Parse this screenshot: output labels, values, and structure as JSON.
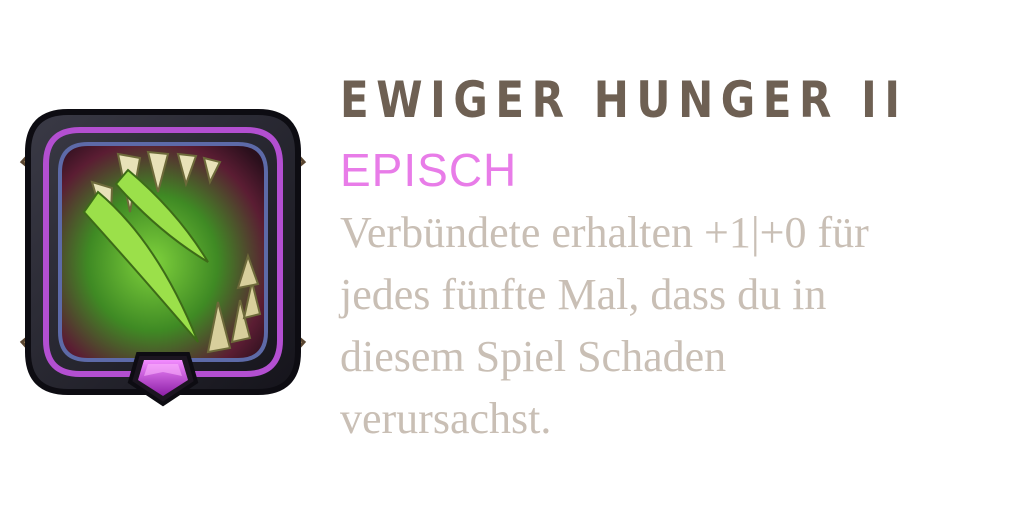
{
  "card": {
    "title": "EWIGER HUNGER II",
    "rarity": "EPISCH",
    "description": "Verbündete erhalten +1|+0 für\njedes fünfte Mal, dass du in\ndiesem Spiel Schaden\nverursachst.",
    "icon": "monster-maw-icon",
    "gem_icon": "pentagon-gem-icon"
  },
  "colors": {
    "title": "#6e6053",
    "rarity": "#e87ce8",
    "description": "#c9bfb5",
    "frame_glow": "#b34fd1",
    "gem": "#c23ad3"
  }
}
